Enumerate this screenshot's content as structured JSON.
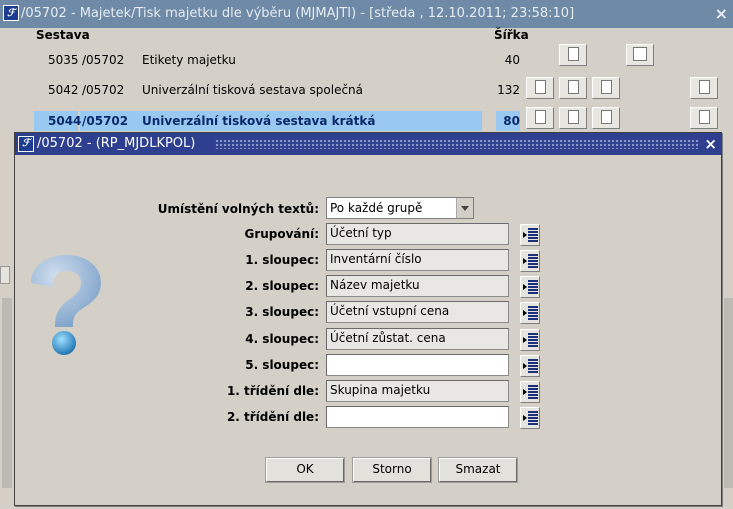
{
  "window": {
    "title": "/05702 - Majetek/Tisk majetku dle výběru (MJMAJTI) - [středa , 12.10.2011; 23:58:10]",
    "close_label": "×"
  },
  "list": {
    "header_sestava": "Sestava",
    "header_sirka": "Šířka",
    "rows": [
      {
        "num": "5035",
        "code": "/05702",
        "name": "Etikety majetku",
        "width": "40"
      },
      {
        "num": "5042",
        "code": "/05702",
        "name": "Univerzální tisková sestava společná",
        "width": "132"
      },
      {
        "num": "5044",
        "code": "/05702",
        "name": "Univerzální tisková sestava krátká",
        "width": "80"
      }
    ]
  },
  "dialog": {
    "title": "/05702 - (RP_MJDLKPOL)",
    "close_label": "×",
    "umisteni_label": "Umístění volných textů:",
    "umisteni_value": "Po každé grupě",
    "fields": [
      {
        "label": "Grupování:",
        "value": "Účetní typ"
      },
      {
        "label": "1. sloupec:",
        "value": "Inventární číslo"
      },
      {
        "label": "2. sloupec:",
        "value": "Název majetku"
      },
      {
        "label": "3. sloupec:",
        "value": "Účetní vstupní cena"
      },
      {
        "label": "4. sloupec:",
        "value": "Účetní zůstat. cena"
      },
      {
        "label": "5. sloupec:",
        "value": ""
      },
      {
        "label": "1. třídění dle:",
        "value": "Skupina majetku"
      },
      {
        "label": "2. třídění dle:",
        "value": ""
      }
    ],
    "ok_label": "OK",
    "storno_label": "Storno",
    "smazat_label": "Smazat"
  },
  "icons": {
    "app": "forms-app-icon",
    "help": "question-mark-icon",
    "lov": "list-of-values-icon"
  },
  "colors": {
    "outer_title_bg": "#6f8aa6",
    "dialog_title_bg": "#2d3f8e",
    "selection": "#99c8f0"
  }
}
